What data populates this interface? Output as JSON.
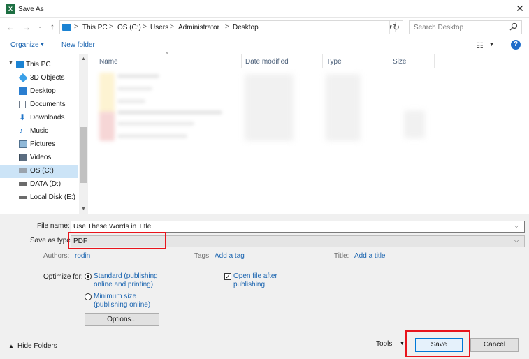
{
  "window": {
    "title": "Save As",
    "app_icon_letter": "X"
  },
  "address_bar": {
    "crumbs": [
      "This PC",
      "OS (C:)",
      "Users",
      "Administrator",
      "Desktop"
    ],
    "separator": ">"
  },
  "search": {
    "placeholder": "Search Desktop"
  },
  "toolbar": {
    "organize_label": "Organize",
    "new_folder_label": "New folder"
  },
  "nav_pane": {
    "items": [
      {
        "label": "This PC",
        "icon": "this-pc-icon",
        "selected": false
      },
      {
        "label": "3D Objects",
        "icon": "3d-objects-icon",
        "selected": false
      },
      {
        "label": "Desktop",
        "icon": "desktop-icon",
        "selected": false
      },
      {
        "label": "Documents",
        "icon": "documents-icon",
        "selected": false
      },
      {
        "label": "Downloads",
        "icon": "downloads-icon",
        "selected": false
      },
      {
        "label": "Music",
        "icon": "music-icon",
        "selected": false
      },
      {
        "label": "Pictures",
        "icon": "pictures-icon",
        "selected": false
      },
      {
        "label": "Videos",
        "icon": "videos-icon",
        "selected": false
      },
      {
        "label": "OS (C:)",
        "icon": "drive-c-icon",
        "selected": true
      },
      {
        "label": "DATA (D:)",
        "icon": "drive-icon",
        "selected": false
      },
      {
        "label": "Local Disk (E:)",
        "icon": "drive-icon",
        "selected": false
      }
    ]
  },
  "file_list": {
    "columns": [
      "Name",
      "Date modified",
      "Type",
      "Size"
    ]
  },
  "form": {
    "file_name_label": "File name:",
    "file_name_value": "Use These Words in Title",
    "save_as_type_label": "Save as type:",
    "save_as_type_value": "PDF",
    "authors_label": "Authors:",
    "authors_value": "rodin",
    "tags_label": "Tags:",
    "tags_value": "Add a tag",
    "title_label": "Title:",
    "title_value": "Add a title",
    "optimize_label": "Optimize for:",
    "opt_standard_line1": "Standard (publishing",
    "opt_standard_line2": "online and printing)",
    "opt_min_line1": "Minimum size",
    "opt_min_line2": "(publishing online)",
    "open_after_line1": "Open file after",
    "open_after_line2": "publishing",
    "options_label": "Options..."
  },
  "footer": {
    "hide_folders_label": "Hide Folders",
    "tools_label": "Tools",
    "save_label": "Save",
    "cancel_label": "Cancel"
  },
  "colors": {
    "highlight": "#e8141c",
    "link": "#1a64b0",
    "selection": "#cce4f7"
  }
}
